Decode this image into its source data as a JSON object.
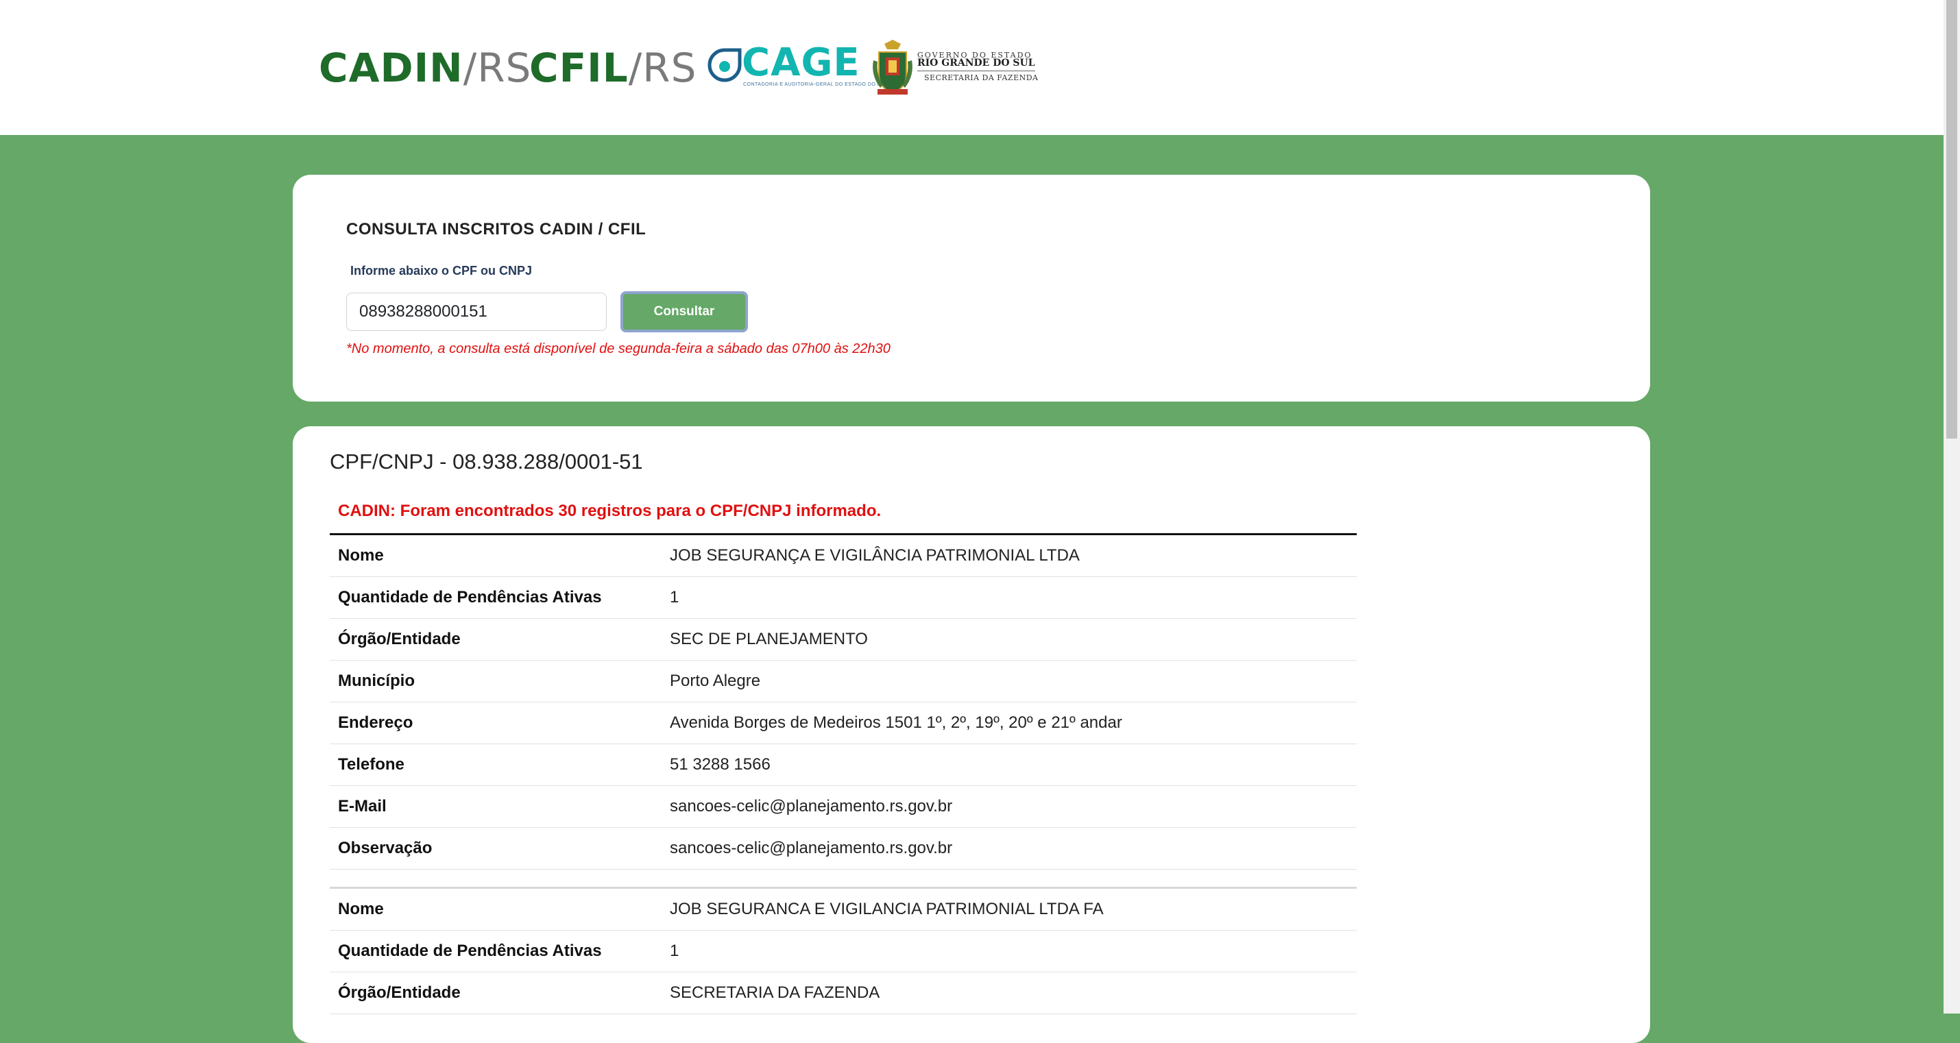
{
  "header": {
    "cadin_logo": {
      "strong": "CADIN",
      "light": "/RS"
    },
    "cfil_logo": {
      "strong": "CFIL",
      "light": "/RS"
    },
    "cage_logo": {
      "word": "CAGE",
      "subtitle": "CONTADORIA E AUDITORIA-GERAL DO ESTADO DO RS"
    },
    "gov_logo": {
      "line1": "GOVERNO DO ESTADO",
      "line2": "RIO GRANDE DO SUL",
      "line3": "SECRETARIA DA FAZENDA"
    }
  },
  "search": {
    "title": "CONSULTA INSCRITOS CADIN / CFIL",
    "label": "Informe abaixo o CPF ou CNPJ",
    "input_value": "08938288000151",
    "button_label": "Consultar",
    "note": "*No momento, a consulta está disponível de segunda-feira a sábado das 07h00 às 22h30"
  },
  "result": {
    "heading": "CPF/CNPJ - 08.938.288/0001-51",
    "alert": "CADIN: Foram encontrados 30 registros para o CPF/CNPJ informado.",
    "records": [
      {
        "rows": [
          {
            "label": "Nome",
            "value": "JOB SEGURANÇA E VIGILÂNCIA PATRIMONIAL LTDA"
          },
          {
            "label": "Quantidade de Pendências Ativas",
            "value": "1"
          },
          {
            "label": "Órgão/Entidade",
            "value": "SEC DE PLANEJAMENTO"
          },
          {
            "label": "Município",
            "value": "Porto Alegre"
          },
          {
            "label": "Endereço",
            "value": "Avenida Borges de Medeiros 1501 1º, 2º, 19º, 20º e 21º andar"
          },
          {
            "label": "Telefone",
            "value": "51 3288 1566"
          },
          {
            "label": "E-Mail",
            "value": "sancoes-celic@planejamento.rs.gov.br"
          },
          {
            "label": "Observação",
            "value": "sancoes-celic@planejamento.rs.gov.br"
          }
        ]
      },
      {
        "rows": [
          {
            "label": "Nome",
            "value": "JOB SEGURANCA E VIGILANCIA PATRIMONIAL LTDA FA"
          },
          {
            "label": "Quantidade de Pendências Ativas",
            "value": "1"
          },
          {
            "label": "Órgão/Entidade",
            "value": "SECRETARIA DA FAZENDA"
          }
        ]
      }
    ]
  },
  "colors": {
    "page_background": "#65a868",
    "logo_green": "#1f6b2a",
    "cage_teal": "#12b5b0",
    "alert_red": "#e01010",
    "button_green": "#65a868",
    "button_focus_ring": "#8fa4cf"
  }
}
